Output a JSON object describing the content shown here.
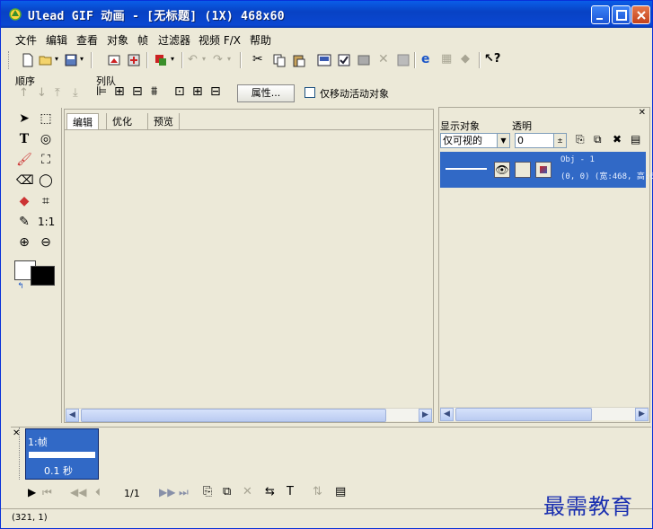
{
  "window": {
    "title": "Ulead GIF 动画 - [无标题] (1X) 468x60"
  },
  "menu": [
    "文件",
    "编辑",
    "查看",
    "对象",
    "帧",
    "过滤器",
    "视频 F/X",
    "帮助"
  ],
  "toolbar2": {
    "order_label": "顺序",
    "queue_label": "列队",
    "properties_button": "属性...",
    "only_move_active_label": "仅移动活动对象"
  },
  "canvas": {
    "tabs": [
      "编辑",
      "优化",
      "预览"
    ]
  },
  "object_panel": {
    "show_label": "显示对象",
    "opacity_label": "透明",
    "show_select": "仅可视的",
    "opacity_value": "0",
    "object": {
      "name": "Obj - 1",
      "info": "(0, 0) (宽:468, 高:6"
    }
  },
  "frames": {
    "frame_label": "1:帧",
    "frame_delay": "0.1 秒",
    "counter": "1/1"
  },
  "status": {
    "coords": "(321, 1)"
  },
  "watermark": "最需教育",
  "colors": {
    "title_bar": "#0a5ee8",
    "selection": "#3169c6",
    "window_bg": "#ece9d8"
  }
}
